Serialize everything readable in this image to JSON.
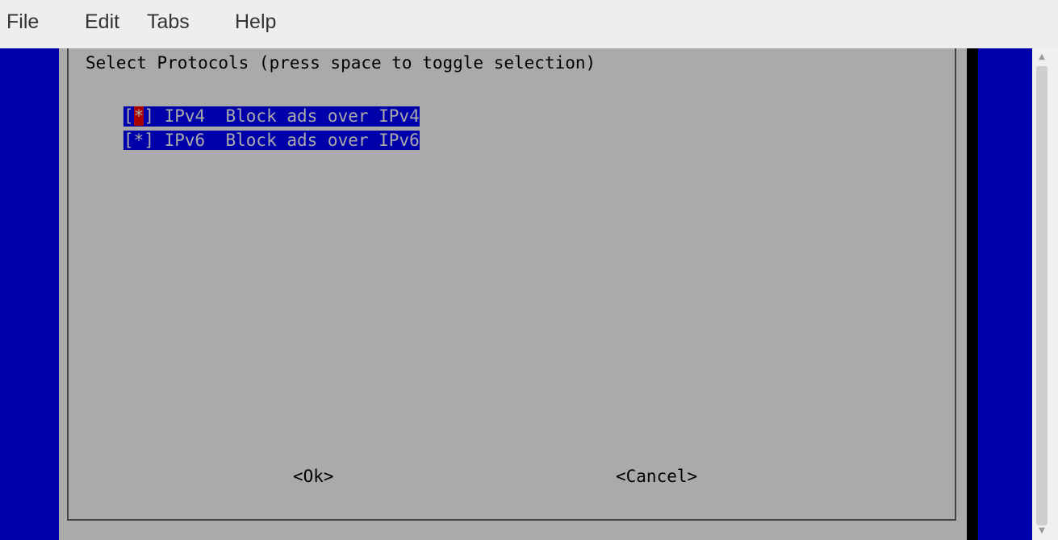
{
  "menubar": {
    "items": [
      "File",
      "Edit",
      "Tabs",
      "Help"
    ]
  },
  "dialog": {
    "prompt": "Select Protocols (press space to toggle selection)",
    "items": [
      {
        "bracket_open": "[",
        "mark": "*",
        "bracket_close": "]",
        "tag": "IPv4",
        "description": "Block ads over IPv4",
        "checked": true,
        "focused": true
      },
      {
        "bracket_open": "[",
        "mark": "*",
        "bracket_close": "]",
        "tag": "IPv6",
        "description": "Block ads over IPv6",
        "checked": true,
        "focused": false
      }
    ],
    "buttons": {
      "ok": "<Ok>",
      "cancel": "<Cancel>"
    }
  },
  "colors": {
    "terminal_background": "#0000aa",
    "dialog_background": "#aaaaaa",
    "dialog_shadow": "#000000",
    "item_highlight": "#0000aa",
    "cursor": "#aa0000",
    "menubar_background": "#eeeeee"
  },
  "icons": {
    "scroll_up": "scroll-up-arrow-icon",
    "scroll_down": "scroll-down-arrow-icon"
  }
}
